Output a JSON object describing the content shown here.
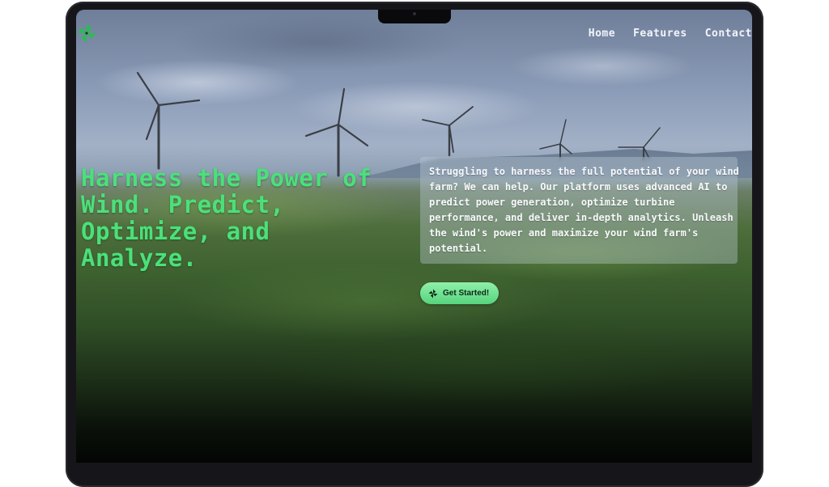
{
  "nav": {
    "items": [
      {
        "label": "Home"
      },
      {
        "label": "Features"
      },
      {
        "label": "Contact"
      }
    ]
  },
  "hero": {
    "headline": "Harness the Power of Wind. Predict, Optimize, and Analyze.",
    "description": "Struggling to harness the full potential of your wind farm? We can help. Our platform uses advanced AI to predict power generation, optimize turbine performance, and deliver in-depth analytics. Unleash the wind's power and maximize your wind farm's potential.",
    "cta_label": "Get Started!"
  },
  "icons": {
    "logo": "pinwheel-icon",
    "cta": "pinwheel-icon"
  },
  "colors": {
    "accent": "#4be07a",
    "button": "#6fe08f"
  }
}
